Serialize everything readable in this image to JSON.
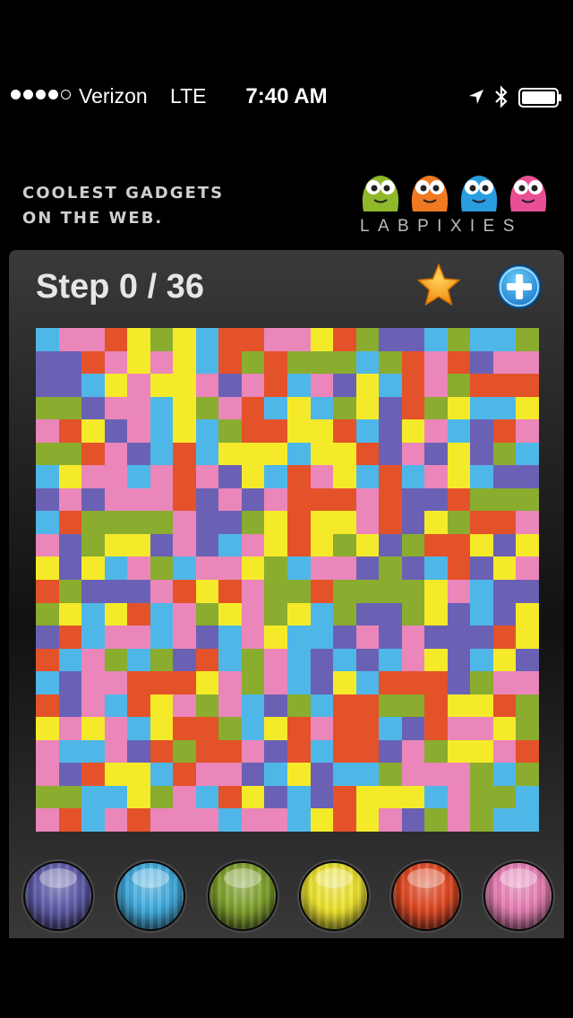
{
  "status_bar": {
    "signal_bars": 5,
    "signal_filled": 4,
    "carrier": "Verizon",
    "network": "LTE",
    "time": "7:40 AM"
  },
  "ad": {
    "tagline": "COOLEST GADGETS\nON THE WEB.",
    "brand": "LABPIXIES",
    "mascot_colors": [
      "#8fb82a",
      "#f07a22",
      "#2a9de0",
      "#ea4f96"
    ]
  },
  "game": {
    "step_label": "Step 0 / 36",
    "current_step": 0,
    "max_steps": 36,
    "grid_size": 22,
    "palette": {
      "P": "#6a61b5",
      "B": "#4fb7e8",
      "G": "#8aac2f",
      "Y": "#f5ea2a",
      "R": "#e4522a",
      "K": "#ea86b9"
    },
    "board": [
      "BKKRYGYBRRKKYRGPPBGBBG",
      "PPRKYKYBRGRGGGBGRKRPKK",
      "PPBYKYYKPKRBKPYBRKGRRR",
      "GGPKKBYGKRBYBGYPRGYBBY",
      "KRYPKBYBGRRYYRBPYKBPRK",
      "GGRKPBRBYYYBYYRPKPYPGB",
      "BYKKBKRKPYBRKYBRBKYBPP",
      "PKPKKKRPKPKRRRKRPPRGGG",
      "BRGGGGKPPGYRYYKRPYGRRK",
      "KPGYYPKPBKYRYGYPGRRYPY",
      "YPYBKGBKKYGBKKPGPBRPYK",
      "RGPPPKRYRKGGRGGGGYKBPP",
      "GYBYRBKGYKGYBGPPGYPBPY",
      "PRBKKBKPBKYBBPKPKPPPRY",
      "RBKGBGPRBGKBPBPBKYPBYP",
      "BPKKRRRYKGKBPYBRRRPGKK",
      "RPKBRYKGKBPGBRRGGRYYRG",
      "YKYKBYRRGBYRKRRBPRKKYG",
      "KBBKPRGRRKPRBRRPKGYYKR",
      "KPRYYBRKKPBYPBBGKKKGBG",
      "GGBBYGKBRYPBPRYYYBKGGB",
      "KRBKRKKKBKKBYRYKPGKGBB",
      "GRKBKYGBRPYGPGBKPGKGPG",
      "GKPBKBRGRYGGRPRBYBGYKY",
      "GRBBKBGBKYYGRGBRYGPYKK",
      "GGGYKYPGKBKRGYGBPYPGPG"
    ],
    "color_buttons": [
      {
        "name": "purple",
        "color": "#5d5aa8"
      },
      {
        "name": "blue",
        "color": "#3da9dd"
      },
      {
        "name": "green",
        "color": "#7ea02a"
      },
      {
        "name": "yellow",
        "color": "#ece22a"
      },
      {
        "name": "red",
        "color": "#e0461f"
      },
      {
        "name": "pink",
        "color": "#e67cb2"
      }
    ]
  }
}
